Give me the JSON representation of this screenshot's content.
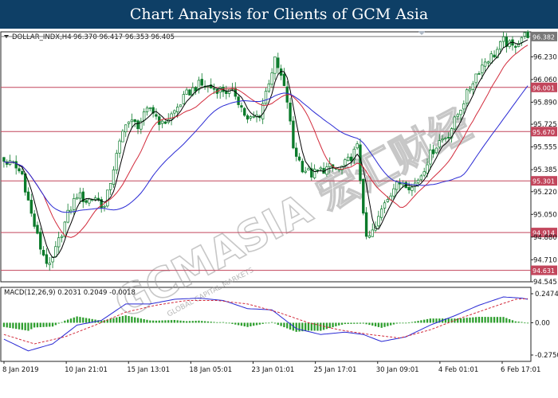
{
  "header": {
    "title": "Chart Analysis for Clients of GCM Asia"
  },
  "watermark": {
    "text": "GCMASIA 宏汇财经",
    "subtext": "GLOBAL CAPITAL MARKETS"
  },
  "chart_data": {
    "type": "candlestick",
    "symbol_label": "DOLLAR_INDX,H4",
    "ohlc_label": "96.370 96.417 96.353 96.405",
    "price_axis": {
      "ticks": [
        "96.230",
        "96.060",
        "95.890",
        "95.725",
        "95.555",
        "95.385",
        "95.220",
        "95.050",
        "94.880",
        "94.710",
        "94.545"
      ],
      "ylim": [
        94.545,
        96.417
      ]
    },
    "time_axis": {
      "labels": [
        "8 Jan 2019",
        "10 Jan 21:01",
        "15 Jan 13:01",
        "18 Jan 05:01",
        "23 Jan 01:01",
        "25 Jan 17:01",
        "30 Jan 09:01",
        "4 Feb 01:01",
        "6 Feb 17:01"
      ]
    },
    "levels": [
      {
        "value": 96.382,
        "label": "96.382",
        "color": "#777777"
      },
      {
        "value": 96.001,
        "label": "96.001",
        "color": "#c2465c"
      },
      {
        "value": 95.67,
        "label": "95.670",
        "color": "#c2465c"
      },
      {
        "value": 95.301,
        "label": "95.301",
        "color": "#c2465c"
      },
      {
        "value": 94.914,
        "label": "94.914",
        "color": "#c2465c"
      },
      {
        "value": 94.631,
        "label": "94.631",
        "color": "#c2465c"
      }
    ],
    "price_anchors": [
      [
        0,
        95.45
      ],
      [
        3,
        95.42
      ],
      [
        6,
        95.35
      ],
      [
        9,
        95.05
      ],
      [
        12,
        94.8
      ],
      [
        15,
        94.65
      ],
      [
        18,
        94.85
      ],
      [
        21,
        95.05
      ],
      [
        24,
        95.2
      ],
      [
        27,
        95.15
      ],
      [
        30,
        95.18
      ],
      [
        33,
        95.1
      ],
      [
        36,
        95.4
      ],
      [
        40,
        95.75
      ],
      [
        44,
        95.72
      ],
      [
        48,
        95.85
      ],
      [
        52,
        95.72
      ],
      [
        56,
        95.82
      ],
      [
        60,
        95.95
      ],
      [
        64,
        96.02
      ],
      [
        68,
        96.0
      ],
      [
        72,
        95.98
      ],
      [
        76,
        95.95
      ],
      [
        80,
        95.75
      ],
      [
        84,
        95.8
      ],
      [
        87,
        96.05
      ],
      [
        89,
        96.2
      ],
      [
        91,
        96.08
      ],
      [
        93,
        95.9
      ],
      [
        95,
        95.55
      ],
      [
        98,
        95.4
      ],
      [
        101,
        95.35
      ],
      [
        104,
        95.38
      ],
      [
        107,
        95.4
      ],
      [
        110,
        95.38
      ],
      [
        113,
        95.45
      ],
      [
        116,
        95.55
      ],
      [
        119,
        94.85
      ],
      [
        122,
        94.95
      ],
      [
        125,
        95.15
      ],
      [
        128,
        95.25
      ],
      [
        131,
        95.3
      ],
      [
        134,
        95.25
      ],
      [
        137,
        95.35
      ],
      [
        140,
        95.5
      ],
      [
        143,
        95.6
      ],
      [
        146,
        95.65
      ],
      [
        149,
        95.8
      ],
      [
        152,
        95.95
      ],
      [
        155,
        96.1
      ],
      [
        158,
        96.2
      ],
      [
        161,
        96.25
      ],
      [
        164,
        96.35
      ],
      [
        167,
        96.3
      ],
      [
        170,
        96.38
      ],
      [
        172,
        96.4
      ]
    ],
    "macd": {
      "label": "MACD(12,26,9) 0.2031 0.2049 -0.0018",
      "ticks": [
        "0.2474",
        "0.00",
        "-0.2750"
      ],
      "ylim": [
        -0.275,
        0.2474
      ],
      "macd_line_anchors": [
        [
          0,
          -0.14
        ],
        [
          8,
          -0.24
        ],
        [
          16,
          -0.18
        ],
        [
          24,
          -0.02
        ],
        [
          32,
          0.02
        ],
        [
          40,
          0.16
        ],
        [
          48,
          0.16
        ],
        [
          56,
          0.2
        ],
        [
          64,
          0.21
        ],
        [
          72,
          0.19
        ],
        [
          80,
          0.12
        ],
        [
          88,
          0.11
        ],
        [
          96,
          -0.05
        ],
        [
          104,
          -0.1
        ],
        [
          112,
          -0.08
        ],
        [
          118,
          -0.1
        ],
        [
          124,
          -0.16
        ],
        [
          132,
          -0.12
        ],
        [
          140,
          -0.02
        ],
        [
          148,
          0.06
        ],
        [
          156,
          0.15
        ],
        [
          164,
          0.22
        ],
        [
          170,
          0.21
        ],
        [
          172,
          0.2
        ]
      ],
      "signal_line_anchors": [
        [
          0,
          -0.1
        ],
        [
          10,
          -0.18
        ],
        [
          20,
          -0.12
        ],
        [
          30,
          -0.02
        ],
        [
          40,
          0.09
        ],
        [
          50,
          0.15
        ],
        [
          60,
          0.19
        ],
        [
          70,
          0.19
        ],
        [
          80,
          0.16
        ],
        [
          90,
          0.09
        ],
        [
          100,
          0.0
        ],
        [
          110,
          -0.06
        ],
        [
          120,
          -0.1
        ],
        [
          130,
          -0.13
        ],
        [
          140,
          -0.06
        ],
        [
          150,
          0.04
        ],
        [
          160,
          0.13
        ],
        [
          168,
          0.2
        ],
        [
          172,
          0.205
        ]
      ]
    },
    "colors": {
      "candle": "#0a7a2a",
      "ma_fast": "#000000",
      "ma_mid": "#d22b3c",
      "ma_slow": "#2a2ad4",
      "macd_hist": "#2e9e2e",
      "macd_line": "#2a2ad4",
      "signal_line": "#d22b3c",
      "header_bg": "#0e3f66"
    }
  }
}
